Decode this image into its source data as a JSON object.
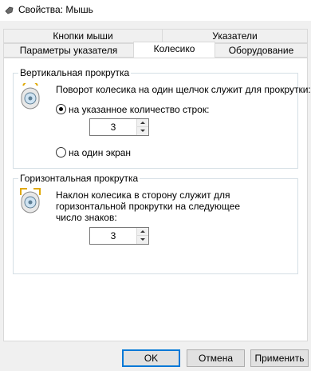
{
  "window": {
    "title": "Свойства: Мышь",
    "icon": "mouse-icon"
  },
  "tabs": {
    "row1": [
      "Кнопки мыши",
      "Указатели"
    ],
    "row2": [
      "Параметры указателя",
      "Колесико",
      "Оборудование"
    ],
    "active": "Колесико"
  },
  "vertical": {
    "group_title": "Вертикальная прокрутка",
    "description": "Поворот колесика на один щелчок служит для прокрутки:",
    "option_lines": "на указанное количество строк:",
    "lines_value": "3",
    "option_screen": "на один экран",
    "selected": "lines"
  },
  "horizontal": {
    "group_title": "Горизонтальная прокрутка",
    "description_line1": "Наклон колесика в сторону служит для",
    "description_line2": "горизонтальной прокрутки на следующее",
    "description_line3": "число знаков:",
    "chars_value": "3"
  },
  "buttons": {
    "ok": "OK",
    "cancel": "Отмена",
    "apply": "Применить"
  }
}
